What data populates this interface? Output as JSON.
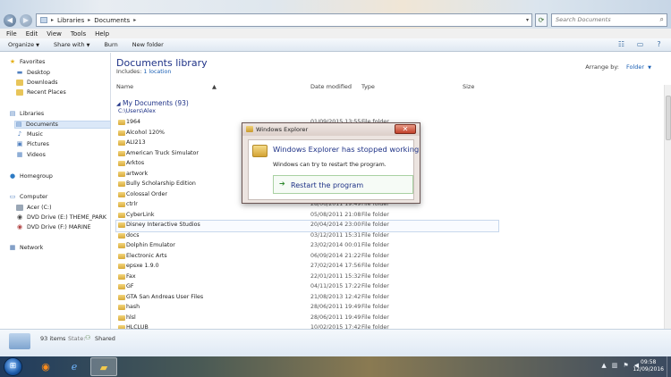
{
  "address": {
    "breadcrumbs": [
      "Libraries",
      "Documents"
    ],
    "search_placeholder": "Search Documents"
  },
  "menu": [
    "File",
    "Edit",
    "View",
    "Tools",
    "Help"
  ],
  "commands": {
    "organize": "Organize",
    "share_with": "Share with",
    "burn": "Burn",
    "new_folder": "New folder"
  },
  "nav": {
    "favorites": "Favorites",
    "desktop": "Desktop",
    "downloads": "Downloads",
    "recent_places": "Recent Places",
    "libraries": "Libraries",
    "documents": "Documents",
    "music": "Music",
    "pictures": "Pictures",
    "videos": "Videos",
    "homegroup": "Homegroup",
    "computer": "Computer",
    "drive_c": "Acer (C:)",
    "drive_e": "DVD Drive (E:) THEME_PARK",
    "drive_f": "DVD Drive (F:) MARINE",
    "network": "Network"
  },
  "library": {
    "title": "Documents library",
    "includes_label": "Includes:",
    "includes_link": "1 location",
    "arrange_label": "Arrange by:",
    "arrange_value": "Folder"
  },
  "columns": {
    "name": "Name",
    "date": "Date modified",
    "type": "Type",
    "size": "Size"
  },
  "group": {
    "title": "My Documents (93)",
    "path": "C:\\Users\\Alex"
  },
  "files": [
    {
      "name": "1964",
      "date": "01/09/2015 13:55",
      "type": "File folder"
    },
    {
      "name": "Alcohol 120%",
      "date": "",
      "type": ""
    },
    {
      "name": "ALI213",
      "date": "",
      "type": ""
    },
    {
      "name": "American Truck Simulator",
      "date": "",
      "type": ""
    },
    {
      "name": "Arktos",
      "date": "",
      "type": ""
    },
    {
      "name": "artwork",
      "date": "",
      "type": ""
    },
    {
      "name": "Bully Scholarship Edition",
      "date": "",
      "type": ""
    },
    {
      "name": "Colossal Order",
      "date": "",
      "type": ""
    },
    {
      "name": "ctrlr",
      "date": "28/06/2011 19:49",
      "type": "File folder"
    },
    {
      "name": "CyberLink",
      "date": "05/08/2011 21:08",
      "type": "File folder"
    },
    {
      "name": "Disney Interactive Studios",
      "date": "20/04/2014 23:00",
      "type": "File folder"
    },
    {
      "name": "docs",
      "date": "03/12/2011 15:31",
      "type": "File folder"
    },
    {
      "name": "Dolphin Emulator",
      "date": "23/02/2014 00:01",
      "type": "File folder"
    },
    {
      "name": "Electronic Arts",
      "date": "06/09/2014 21:22",
      "type": "File folder"
    },
    {
      "name": "epsxe 1.9.0",
      "date": "27/02/2014 17:56",
      "type": "File folder"
    },
    {
      "name": "Fax",
      "date": "22/01/2011 15:32",
      "type": "File folder"
    },
    {
      "name": "GF",
      "date": "04/11/2015 17:22",
      "type": "File folder"
    },
    {
      "name": "GTA San Andreas User Files",
      "date": "21/08/2013 12:42",
      "type": "File folder"
    },
    {
      "name": "hash",
      "date": "28/06/2011 19:49",
      "type": "File folder"
    },
    {
      "name": "hlsl",
      "date": "28/06/2011 19:49",
      "type": "File folder"
    },
    {
      "name": "HLCLUB",
      "date": "10/02/2015 17:42",
      "type": "File folder"
    }
  ],
  "details": {
    "count": "93 items",
    "state_label": "State:",
    "state_value": "Shared"
  },
  "dialog": {
    "title": "Windows Explorer",
    "heading": "Windows Explorer has stopped working",
    "message": "Windows can try to restart the program.",
    "option": "Restart the program"
  },
  "clock": {
    "time": "09:58",
    "date": "12/09/2016"
  },
  "icons": {
    "start": "windows-orb-icon",
    "browser1": "firefox-icon",
    "browser2": "internet-explorer-icon",
    "explorer": "folder-icon"
  }
}
